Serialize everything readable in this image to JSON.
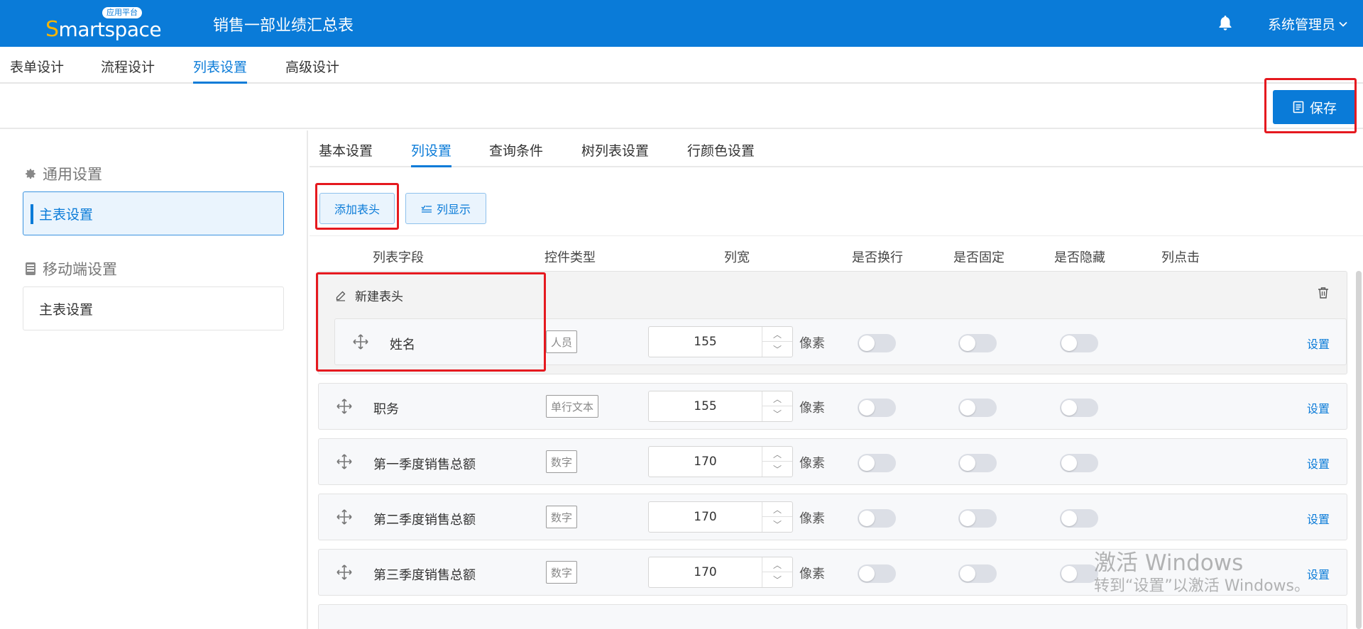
{
  "header": {
    "logo_text_s": "S",
    "logo_text_rest": "martspace",
    "logo_badge": "应用平台",
    "title": "销售一部业绩汇总表",
    "user": "系统管理员",
    "color": "#0a7bd8"
  },
  "main_tabs": [
    "表单设计",
    "流程设计",
    "列表设置",
    "高级设计"
  ],
  "active_main_tab": "列表设置",
  "toolbar": {
    "save_label": "保存"
  },
  "sidebar": {
    "group1": "通用设置",
    "group1_item": "主表设置",
    "group2": "移动端设置",
    "group2_item": "主表设置"
  },
  "sub_tabs": [
    "基本设置",
    "列设置",
    "查询条件",
    "树列表设置",
    "行颜色设置"
  ],
  "active_sub_tab": "列设置",
  "buttons": {
    "add_header": "添加表头",
    "column_display": "列显示"
  },
  "columns": [
    "列表字段",
    "控件类型",
    "列宽",
    "是否换行",
    "是否固定",
    "是否隐藏",
    "列点击"
  ],
  "group": {
    "title": "新建表头"
  },
  "unit_label": "像素",
  "set_label": "设置",
  "rows": [
    {
      "field": "姓名",
      "control": "人员",
      "width": "155",
      "wrap": false,
      "fixed": false,
      "hidden": false
    },
    {
      "field": "职务",
      "control": "单行文本",
      "width": "155",
      "wrap": false,
      "fixed": false,
      "hidden": false
    },
    {
      "field": "第一季度销售总额",
      "control": "数字",
      "width": "170",
      "wrap": false,
      "fixed": false,
      "hidden": false
    },
    {
      "field": "第二季度销售总额",
      "control": "数字",
      "width": "170",
      "wrap": false,
      "fixed": false,
      "hidden": false
    },
    {
      "field": "第三季度销售总额",
      "control": "数字",
      "width": "170",
      "wrap": false,
      "fixed": false,
      "hidden": false
    }
  ],
  "watermark": {
    "line1": "激活 Windows",
    "line2": "转到“设置”以激活 Windows。"
  }
}
